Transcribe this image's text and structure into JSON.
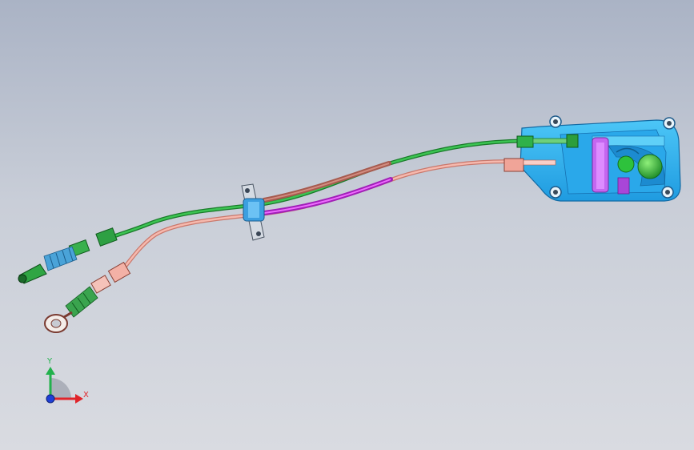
{
  "viewport": {
    "background_top": "#aab3c5",
    "background_bottom": "#d9dbe1"
  },
  "colors": {
    "housing": "#2fb6f2",
    "housing_dark": "#1b78b8",
    "cable_green": "#27a13a",
    "cable_pink": "#f2aaa0",
    "sleeve_brown": "#b56a5c",
    "sleeve_magenta": "#d432e6",
    "lever": "#c060f0",
    "knob": "#2ec23c"
  },
  "parts": {
    "shifter_housing": "shifter-housing",
    "green_cable": "select-cable",
    "pink_cable": "shift-cable",
    "bulkhead_bracket": "bulkhead-bracket"
  },
  "triad": {
    "y_label": "Y",
    "x_label": "X",
    "y_color": "#22b14c",
    "x_color": "#e0242a",
    "z_color": "#1f3fd6"
  }
}
